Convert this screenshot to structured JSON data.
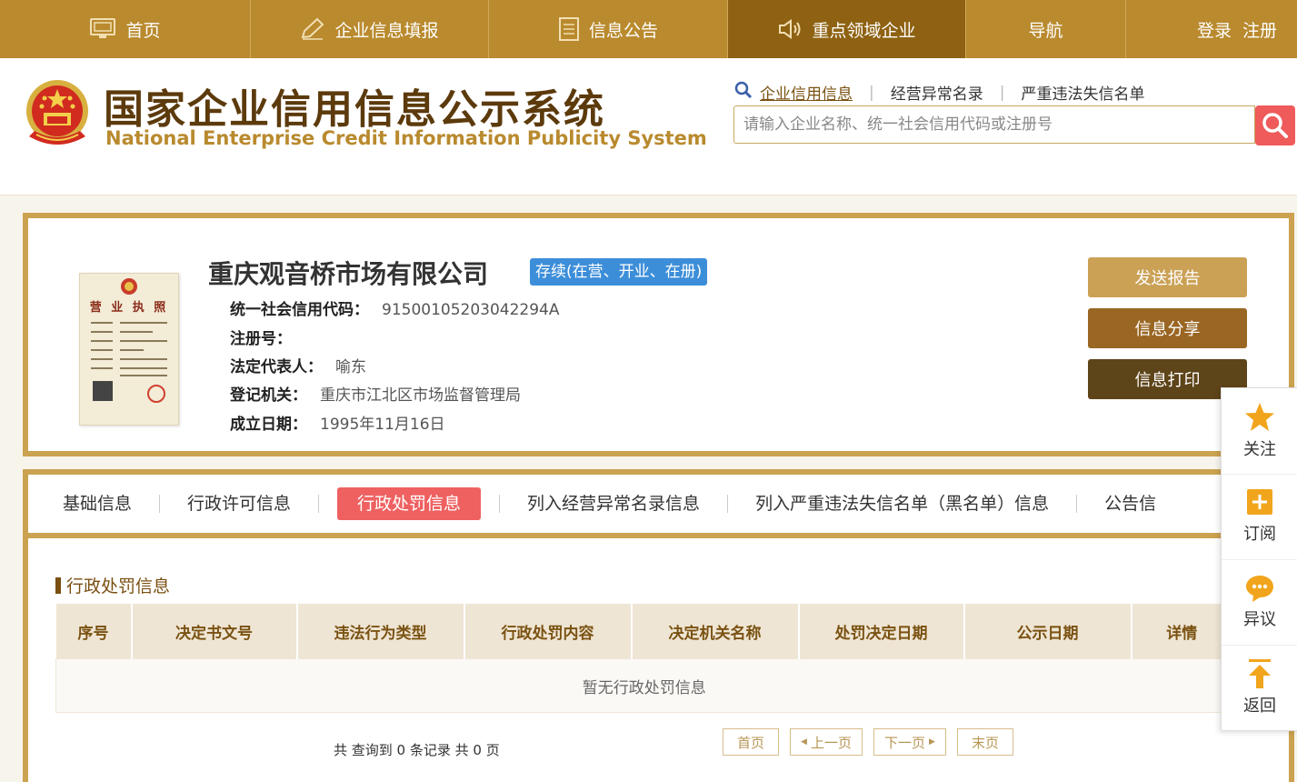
{
  "topnav": {
    "items": [
      {
        "label": "首页",
        "icon": "monitor-icon"
      },
      {
        "label": "企业信息填报",
        "icon": "pen-icon"
      },
      {
        "label": "信息公告",
        "icon": "document-icon"
      },
      {
        "label": "重点领域企业",
        "icon": "speaker-icon"
      },
      {
        "label": "导航",
        "icon": ""
      }
    ],
    "login": "登录",
    "register": "注册"
  },
  "header": {
    "title_cn": "国家企业信用信息公示系统",
    "title_en": "National Enterprise Credit Information Publicity System",
    "search_tabs": [
      "企业信用信息",
      "经营异常名录",
      "严重违法失信名单"
    ],
    "search_placeholder": "请输入企业名称、统一社会信用代码或注册号"
  },
  "company": {
    "license_title": "营 业 执 照",
    "name": "重庆观音桥市场有限公司",
    "status": "存续(在营、开业、在册)",
    "credit_code_label": "统一社会信用代码：",
    "credit_code": "91500105203042294A",
    "reg_no_label": "注册号：",
    "reg_no": "",
    "legal_rep_label": "法定代表人：",
    "legal_rep": "喻东",
    "authority_label": "登记机关：",
    "authority": "重庆市江北区市场监督管理局",
    "founded_label": "成立日期：",
    "founded": "1995年11月16日"
  },
  "actions": {
    "send_report": "发送报告",
    "share": "信息分享",
    "print": "信息打印"
  },
  "detail": {
    "tabs": [
      "基础信息",
      "行政许可信息",
      "行政处罚信息",
      "列入经营异常名录信息",
      "列入严重违法失信名单（黑名单）信息",
      "公告信"
    ],
    "active_tab": "行政处罚信息",
    "section_title": "行政处罚信息",
    "table_headers": [
      "序号",
      "决定书文号",
      "违法行为类型",
      "行政处罚内容",
      "决定机关名称",
      "处罚决定日期",
      "公示日期",
      "详情"
    ],
    "empty_text": "暂无行政处罚信息",
    "pager_summary": "共 查询到 0 条记录 共 0 页",
    "pager": {
      "first": "首页",
      "prev": "上一页",
      "next": "下一页",
      "last": "末页"
    }
  },
  "float_menu": [
    {
      "label": "关注",
      "icon": "star-icon"
    },
    {
      "label": "订阅",
      "icon": "plus-box-icon"
    },
    {
      "label": "异议",
      "icon": "chat-bubble-icon"
    },
    {
      "label": "返回",
      "icon": "back-to-top-icon"
    }
  ],
  "colors": {
    "gold": "#b98a2e",
    "dark_gold": "#8e6212",
    "red": "#ef5a5a",
    "blue_badge": "#3d8ed9"
  }
}
